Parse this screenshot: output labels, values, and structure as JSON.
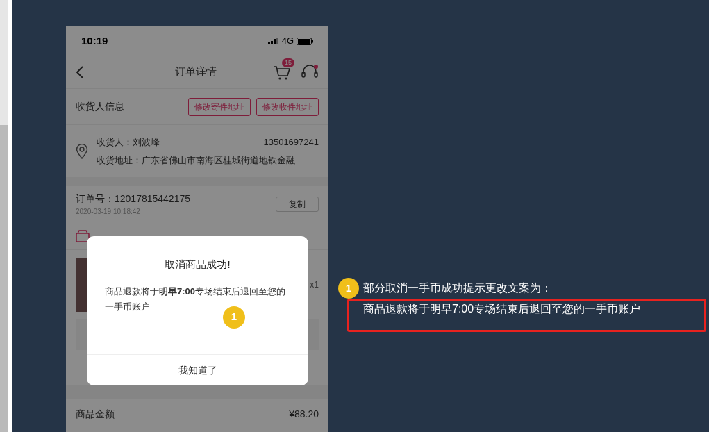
{
  "phone": {
    "status_bar": {
      "time": "10:19",
      "network": "4G"
    },
    "nav": {
      "title": "订单详情",
      "cart_count": "15"
    },
    "recipient": {
      "heading": "收货人信息",
      "buttons": [
        "修改寄件地址",
        "修改收件地址"
      ],
      "name": "收货人：刘波峰",
      "phone": "13501697241",
      "address": "收货地址：广东省佛山市南海区桂城街道地铁金融"
    },
    "order": {
      "number": "订单号：12017815442175",
      "date": "2020-03-19 10:18:42",
      "copy_button": "复制"
    },
    "product": {
      "quantity": "x1"
    },
    "summary": {
      "label": "商品金额",
      "value": "¥88.20"
    },
    "dialog": {
      "title": "取消商品成功!",
      "message": "商品退款将于**明早7:00**专场结束后退回至您的一手币账户",
      "button": "我知道了",
      "marker": "1"
    }
  },
  "annotation": {
    "marker": "1",
    "title": "部分取消一手币成功提示更改文案为：",
    "text": "商品退款将于明早7:00专场结束后退回至您的一手币账户"
  }
}
